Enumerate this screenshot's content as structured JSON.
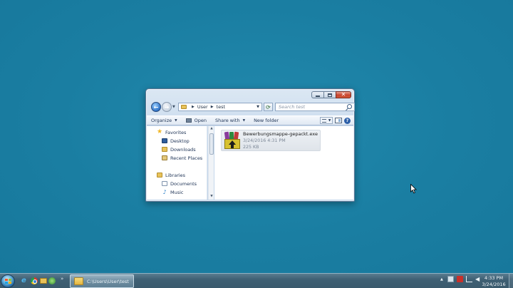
{
  "window": {
    "address": {
      "crumbs": [
        "User",
        "test"
      ]
    },
    "search": {
      "placeholder": "Search test"
    },
    "toolbar": {
      "organize_label": "Organize",
      "open_label": "Open",
      "share_label": "Share with",
      "new_folder_label": "New folder"
    },
    "nav_pane": {
      "favorites_label": "Favorites",
      "favorites": [
        "Desktop",
        "Downloads",
        "Recent Places"
      ],
      "libraries_label": "Libraries",
      "libraries": [
        "Documents",
        "Music"
      ]
    },
    "files": [
      {
        "name": "Bewerbungsmappe-gepackt.exe",
        "modified": "3/24/2016 4:31 PM",
        "size": "225 KB",
        "icon": "winrar-sfx-icon"
      }
    ]
  },
  "taskbar": {
    "active_task_label": "C:\\Users\\User\\test",
    "clock": {
      "time": "4:33 PM",
      "date": "3/24/2016"
    }
  },
  "colors": {
    "desktop_background": "#1b7fa3",
    "taskbar": "#3f6074",
    "close_button": "#c8442e"
  }
}
